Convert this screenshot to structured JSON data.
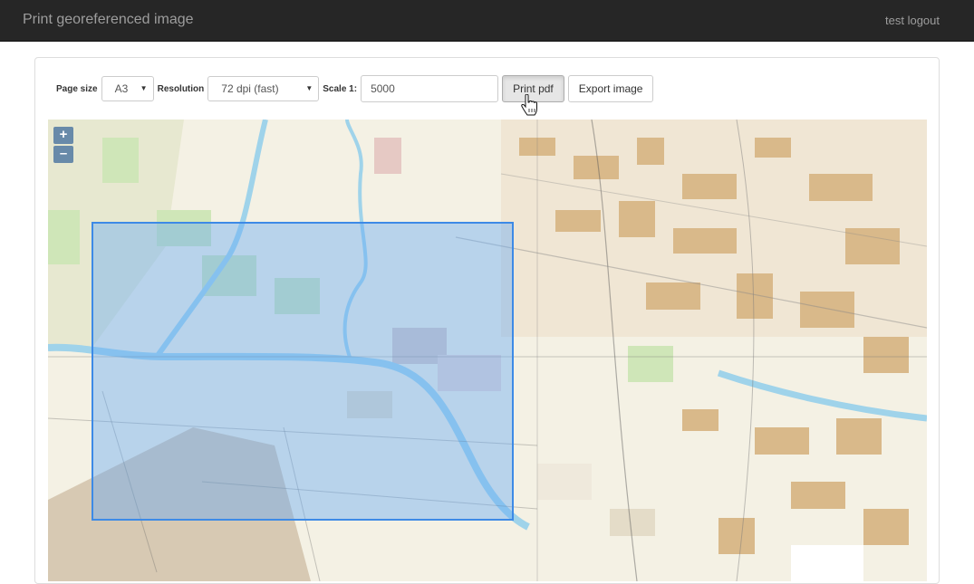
{
  "header": {
    "title": "Print georeferenced image",
    "user": "test",
    "logout_label": "logout"
  },
  "toolbar": {
    "page_size_label": "Page size",
    "page_size_value": "A3",
    "resolution_label": "Resolution",
    "resolution_value": "72 dpi (fast)",
    "scale_label": "Scale 1:",
    "scale_value": "5000",
    "print_pdf_label": "Print pdf",
    "export_image_label": "Export image"
  },
  "map": {
    "zoom_in": "+",
    "zoom_out": "–"
  },
  "colors": {
    "navbar": "#262626",
    "extent_border": "#3d8ae6",
    "extent_fill": "rgba(100,170,245,0.42)",
    "water": "#9fd3ea",
    "builtup": "#d9b98a",
    "grass": "#cfe6b8"
  },
  "icons": {
    "cursor": "hand-pointer-icon",
    "caret": "caret-down-icon"
  }
}
